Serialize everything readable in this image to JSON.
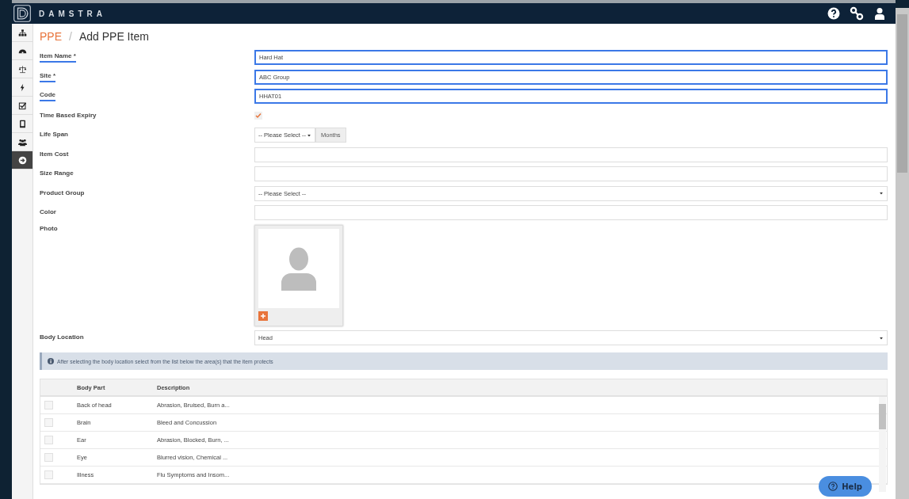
{
  "header": {
    "brand": "DAMSTRA"
  },
  "sidebar": {
    "items": [
      {
        "selected": false
      },
      {
        "selected": false
      },
      {
        "selected": false
      },
      {
        "selected": false
      },
      {
        "selected": false
      },
      {
        "selected": false
      },
      {
        "selected": false
      },
      {
        "selected": true
      }
    ]
  },
  "breadcrumb": {
    "parent": "PPE",
    "separator": "/",
    "current": "Add PPE Item"
  },
  "form": {
    "fields": [
      {
        "kind": "text",
        "label": "Item Name *",
        "value": "Hard Hat",
        "highlighted": true
      },
      {
        "kind": "text",
        "label": "Site *",
        "value": "ABC Group",
        "highlighted": true
      },
      {
        "kind": "text",
        "label": "Code",
        "value": "HHAT01",
        "highlighted": true
      },
      {
        "kind": "checkbox",
        "label": "Time Based Expiry",
        "checked": true
      },
      {
        "kind": "lifespan",
        "label": "Life Span",
        "value": "-- Please Select --",
        "addon": "Months"
      },
      {
        "kind": "text",
        "label": "Item Cost",
        "highlighted": false
      },
      {
        "kind": "text",
        "label": "Size Range",
        "highlighted": false
      },
      {
        "kind": "select",
        "label": "Product Group",
        "value": "-- Please Select --"
      },
      {
        "kind": "text",
        "label": "Color",
        "highlighted": false
      },
      {
        "kind": "photo",
        "label": "Photo"
      },
      {
        "kind": "select",
        "label": "Body Location",
        "value": "Head"
      }
    ]
  },
  "info": {
    "text": "After selecting the body location select from the list below the area(s) that the item protects"
  },
  "table": {
    "columns": [
      "Body Part",
      "Description"
    ],
    "rows": [
      {
        "checked": false,
        "body_part": "Back of head",
        "description": "Abrasion, Bruised, Burn a..."
      },
      {
        "checked": false,
        "body_part": "Brain",
        "description": "Bleed and Concussion"
      },
      {
        "checked": false,
        "body_part": "Ear",
        "description": "Abrasion, Blocked, Burn, ..."
      },
      {
        "checked": false,
        "body_part": "Eye",
        "description": "Blurred vision, Chemical ..."
      },
      {
        "checked": false,
        "body_part": "Illness",
        "description": "Flu Symptoms and Insom..."
      }
    ]
  },
  "help_button": {
    "label": "Help"
  }
}
